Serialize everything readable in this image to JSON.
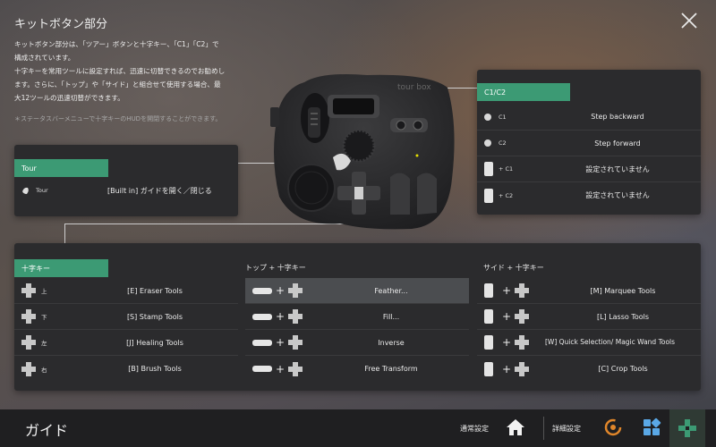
{
  "page": {
    "title": "キットボタン部分",
    "description": [
      "キットボタン部分は、「ツアー」ボタンと十字キー、「C1」「C2」で",
      "構成されています。",
      "十字キーを常用ツールに設定すれば、迅速に切替できるのでお勧めし",
      "ます。さらに、「トップ」や「サイド」と組合せて使用する場合、最",
      "大12ツールの迅速切替ができます。"
    ],
    "note": "＊ステータスバーメニューで十字キーのHUDを開閉することができます。"
  },
  "tour_panel": {
    "header": "Tour",
    "row": {
      "key": "Tour",
      "value": "[Built in] ガイドを開く／閉じる"
    }
  },
  "c_panel": {
    "header": "C1/C2",
    "rows": [
      {
        "key": "C1",
        "value": "Step backward",
        "icon": "dot"
      },
      {
        "key": "C2",
        "value": "Step forward",
        "icon": "dot"
      },
      {
        "key": "+ C1",
        "value": "設定されていません",
        "icon": "side-pad"
      },
      {
        "key": "+ C2",
        "value": "設定されていません",
        "icon": "side-pad"
      }
    ]
  },
  "dpad_panel": {
    "col1": {
      "header": "十字キー",
      "rows": [
        {
          "key": "上",
          "value": "[E] Eraser Tools"
        },
        {
          "key": "下",
          "value": "[S] Stamp Tools"
        },
        {
          "key": "左",
          "value": "[J] Healing Tools"
        },
        {
          "key": "右",
          "value": "[B] Brush Tools"
        }
      ]
    },
    "col2": {
      "header": "トップ + 十字キー",
      "rows": [
        {
          "value": "Feather...",
          "selected": true
        },
        {
          "value": "Fill..."
        },
        {
          "value": "Inverse"
        },
        {
          "value": "Free Transform"
        }
      ]
    },
    "col3": {
      "header": "サイド + 十字キー",
      "rows": [
        {
          "value": "[M] Marquee Tools"
        },
        {
          "value": "[L] Lasso Tools"
        },
        {
          "value": "[W] Quick Selection/ Magic Wand Tools"
        },
        {
          "value": "[C] Crop Tools"
        }
      ]
    }
  },
  "bottom": {
    "title": "ガイド",
    "normal_settings": "通常設定",
    "advanced_settings": "詳細設定"
  },
  "device": {
    "logo": "tour box"
  },
  "colors": {
    "accent": "#3c9a74",
    "panel": "#2b2b2d",
    "bottom_bar": "#1f1f21",
    "orange_icon": "#e0862a",
    "blue_icon": "#5aa8e6"
  }
}
